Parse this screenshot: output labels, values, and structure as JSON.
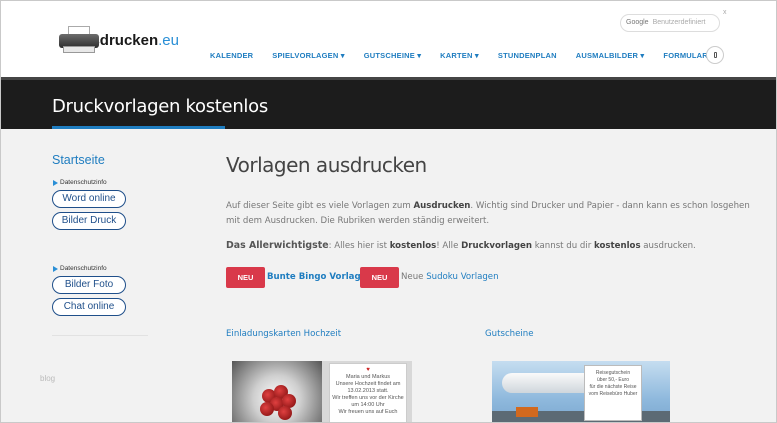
{
  "header": {
    "logo": {
      "part1": "ausdrucken",
      "part2": ".eu"
    },
    "search": {
      "brand": "Google",
      "placeholder": "Benutzerdefiniert"
    },
    "corner_mark": "x",
    "nav": [
      {
        "label": "KALENDER"
      },
      {
        "label": "SPIELVORLAGEN ▾"
      },
      {
        "label": "GUTSCHEINE ▾"
      },
      {
        "label": "KARTEN ▾"
      },
      {
        "label": "STUNDENPLAN"
      },
      {
        "label": "AUSMALBILDER ▾"
      },
      {
        "label": "FORMULARE ▾"
      }
    ],
    "mobile_icon": "mobile-phone-icon"
  },
  "banner": {
    "title": "Druckvorlagen kostenlos"
  },
  "sidebar": {
    "title": "Startseite",
    "groups": [
      {
        "ad_label": "Datenschutzinfo",
        "buttons": [
          "Word online",
          "Bilder Druck"
        ]
      },
      {
        "ad_label": "Datenschutzinfo",
        "buttons": [
          "Bilder Foto",
          "Chat online"
        ]
      }
    ],
    "footer": "blog"
  },
  "main": {
    "title": "Vorlagen ausdrucken",
    "intro": {
      "t1": "Auf dieser Seite gibt es viele Vorlagen zum ",
      "b1": "Ausdrucken",
      "t2": ". Wichtig sind Drucker und Papier - dann kann es schon losgehen mit dem Ausdrucken. Die Rubriken werden ständig erweitert."
    },
    "important": {
      "lead": "Das Allerwichtigste",
      "t1": ": Alles hier ist ",
      "b1": "kostenlos",
      "t2": "! Alle ",
      "b2": "Druckvorlagen",
      "t3": " kannst du dir ",
      "b3": "kostenlos",
      "t4": " ausdrucken."
    },
    "news": [
      {
        "badge": "NEU",
        "link": "Bunte Bingo Vorlagen"
      },
      {
        "badge": "NEU",
        "prefix": "Neue ",
        "link": "Sudoku Vorlagen"
      }
    ],
    "categories": [
      {
        "title": "Einladungskarten Hochzeit",
        "card_lines": [
          "Maria und Markus",
          "Unsere Hochzeit findet am",
          "13.02.2013 statt.",
          "Wir treffen uns vor der Kirche",
          "um 14:00 Uhr",
          "Wir freuen uns auf Euch"
        ]
      },
      {
        "title": "Gutscheine",
        "card_lines": [
          "Reisegutschein",
          "über 50,- Euro",
          "für die nächste Reise",
          "vom Reisebüro Huber"
        ]
      }
    ]
  },
  "colors": {
    "accent": "#1f7dc0",
    "badge": "#d9394a",
    "banner": "#1c1c1c"
  }
}
